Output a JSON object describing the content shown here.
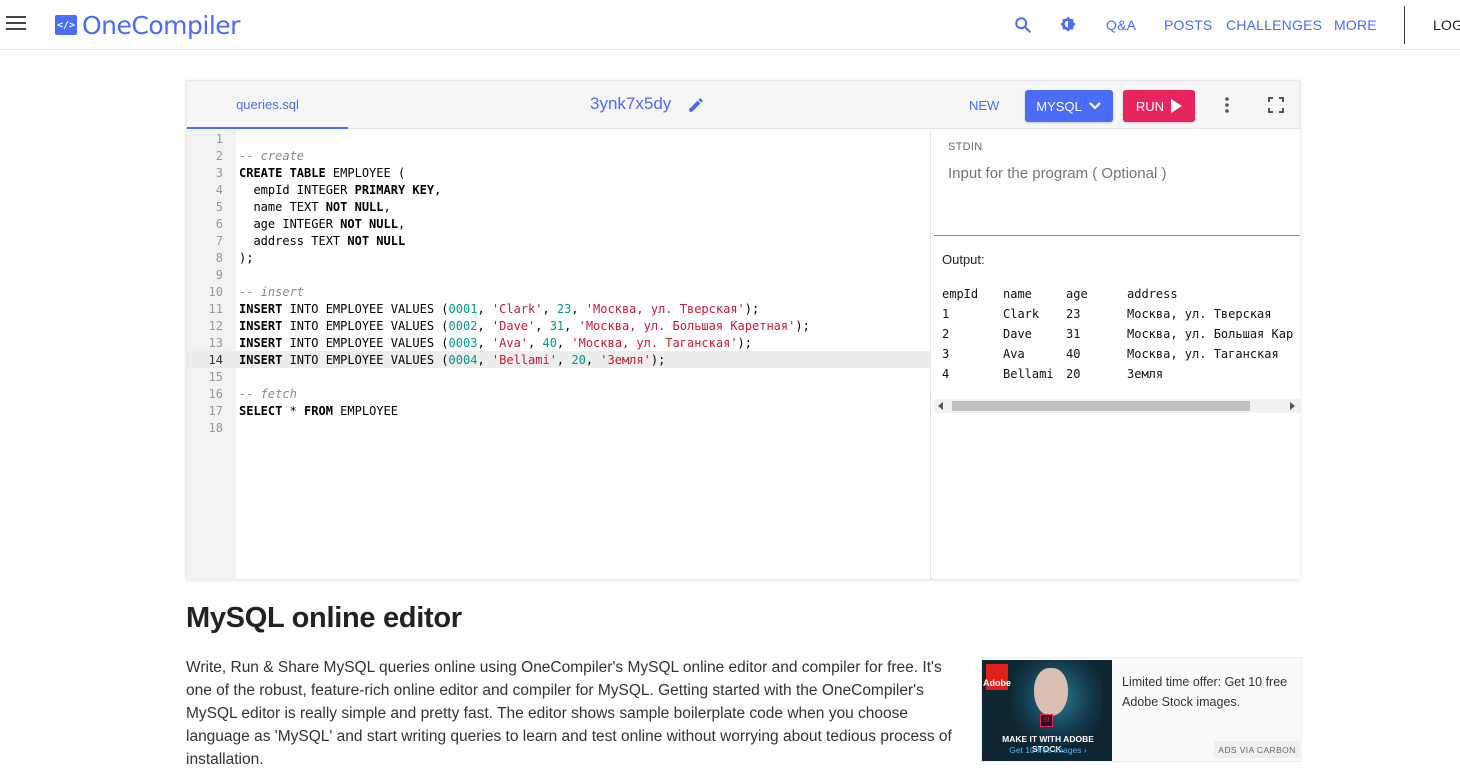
{
  "nav": {
    "logo_mark": "</>",
    "logo_text": "OneCompiler",
    "links": [
      "Q&A",
      "POSTS",
      "CHALLENGES",
      "MORE",
      "LOG"
    ]
  },
  "editor": {
    "file_tab": "queries.sql",
    "code_id": "3ynk7x5dy",
    "new_label": "NEW",
    "language_label": "MYSQL",
    "run_label": "RUN",
    "line_numbers": [
      "1",
      "2",
      "3",
      "4",
      "5",
      "6",
      "7",
      "8",
      "9",
      "10",
      "11",
      "12",
      "13",
      "14",
      "15",
      "16",
      "17",
      "18"
    ],
    "active_line": 14,
    "code": {
      "c2": "-- create",
      "c3_kw": "CREATE TABLE",
      "c3_rest": " EMPLOYEE (",
      "c4_a": "  empId INTEGER ",
      "c4_kw": "PRIMARY KEY",
      "c4_b": ",",
      "c5_a": "  name TEXT ",
      "c5_kw": "NOT NULL",
      "c5_b": ",",
      "c6_a": "  age INTEGER ",
      "c6_kw": "NOT NULL",
      "c6_b": ",",
      "c7_a": "  address TEXT ",
      "c7_kw": "NOT NULL",
      "c8": ");",
      "c10": "-- insert",
      "insert_kw": "INSERT",
      "insert_mid": " INTO EMPLOYEE VALUES (",
      "rows": [
        {
          "id": "0001",
          "name": "'Clark'",
          "age": "23",
          "addr": "'Москва, ул. Тверская'"
        },
        {
          "id": "0002",
          "name": "'Dave'",
          "age": "31",
          "addr": "'Москва, ул. Большая Каретная'"
        },
        {
          "id": "0003",
          "name": "'Ava'",
          "age": "40",
          "addr": "'Москва, ул. Таганская'"
        },
        {
          "id": "0004",
          "name": "'Bellami'",
          "age": "20",
          "addr": "'Земля'"
        }
      ],
      "sep": ", ",
      "end": ");",
      "c16": "-- fetch",
      "c17_kw1": "SELECT",
      "c17_mid": " * ",
      "c17_kw2": "FROM",
      "c17_rest": " EMPLOYEE"
    }
  },
  "stdin": {
    "label": "STDIN",
    "placeholder": "Input for the program ( Optional )"
  },
  "output": {
    "title": "Output:",
    "headers": [
      "empId",
      "name",
      "age",
      "address"
    ],
    "rows": [
      [
        "1",
        "Clark",
        "23",
        "Москва, ул. Тверская"
      ],
      [
        "2",
        "Dave",
        "31",
        "Москва, ул. Большая Кар"
      ],
      [
        "3",
        "Ava",
        "40",
        "Москва, ул. Таганская"
      ],
      [
        "4",
        "Bellami",
        "20",
        "Земля"
      ]
    ]
  },
  "article": {
    "title": "MySQL online editor",
    "intro": "Write, Run & Share MySQL queries online using OneCompiler's MySQL online editor and compiler for free. It's one of the robust, feature-rich online editor and compiler for MySQL. Getting started with the OneCompiler's MySQL editor is really simple and pretty fast. The editor shows sample boilerplate code when you choose language as 'MySQL' and start writing queries to learn and test online without worrying about tedious process of installation."
  },
  "ad": {
    "brand_mark": "Adobe",
    "product_mark": "St",
    "headline": "MAKE IT WITH ADOBE STOCK.",
    "sub": "Get 10 free images ›",
    "text": "Limited time offer: Get 10 free Adobe Stock images.",
    "tag": "ADS VIA CARBON"
  },
  "colors": {
    "accent": "#4a6cf7",
    "run": "#e8245f",
    "stdin_border": "#3bbf8a"
  }
}
